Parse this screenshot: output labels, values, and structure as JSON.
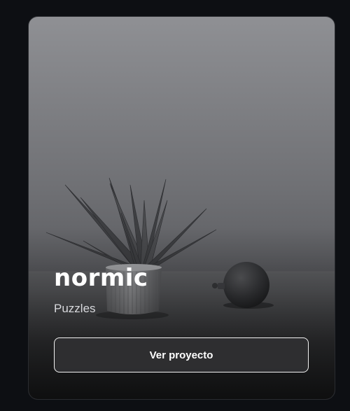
{
  "card": {
    "title": "normic",
    "subtitle": "Puzzles",
    "button_label": "Ver proyecto",
    "image_subject": "potted plant and round ornament"
  },
  "colors": {
    "page_background": "#0d0f13",
    "title": "#ffffff",
    "subtitle": "#d8d9dd",
    "button_border": "#f2f2f2"
  }
}
